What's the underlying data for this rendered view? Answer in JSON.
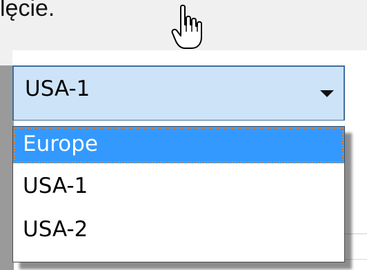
{
  "caption": "lęcie.",
  "dropdown": {
    "selected_value": "USA-1",
    "options": [
      {
        "label": "Europe",
        "highlighted": true
      },
      {
        "label": "USA-1",
        "highlighted": false
      },
      {
        "label": "USA-2",
        "highlighted": false
      }
    ]
  },
  "cursor": {
    "icon": "hand-pointer-icon"
  },
  "colors": {
    "select_background": "#cde3f8",
    "highlight": "#3399ff",
    "focus_outline": "#e0843a"
  }
}
